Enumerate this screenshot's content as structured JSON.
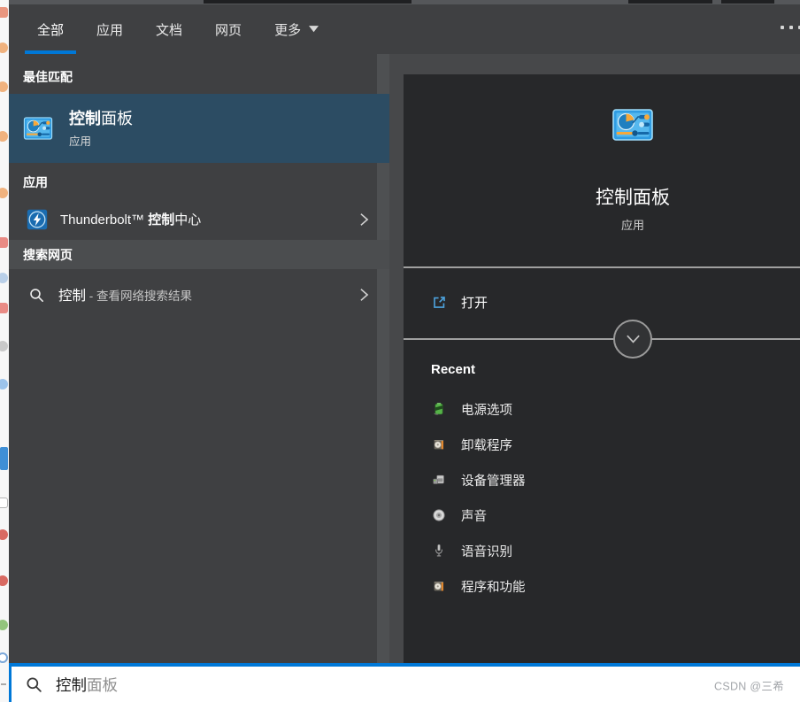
{
  "header": {
    "tabs": [
      {
        "label": "全部"
      },
      {
        "label": "应用"
      },
      {
        "label": "文档"
      },
      {
        "label": "网页"
      },
      {
        "label": "更多"
      }
    ],
    "active_tab": "全部"
  },
  "left_pane": {
    "best_match_header": "最佳匹配",
    "best_match": {
      "title_match": "控制",
      "title_rest": "面板",
      "subtitle": "应用"
    },
    "apps_header": "应用",
    "app_result": {
      "prefix": "Thunderbolt™ ",
      "match": "控制",
      "suffix": "中心"
    },
    "web_header": "搜索网页",
    "web_result": {
      "query": "控制",
      "hint": " - 查看网络搜索结果"
    }
  },
  "right_pane": {
    "app_title": "控制面板",
    "app_subtitle": "应用",
    "open_label": "打开",
    "recent_header": "Recent",
    "recent_items": [
      {
        "icon": "battery-icon",
        "label": "电源选项"
      },
      {
        "icon": "uninstall-program-icon",
        "label": "卸载程序"
      },
      {
        "icon": "device-manager-icon",
        "label": "设备管理器"
      },
      {
        "icon": "sound-icon",
        "label": "声音"
      },
      {
        "icon": "microphone-icon",
        "label": "语音识别"
      },
      {
        "icon": "programs-features-icon",
        "label": "程序和功能"
      }
    ]
  },
  "search_bar": {
    "typed_text": "控制",
    "suggestion_text": "面板"
  },
  "watermark": "CSDN @三希",
  "colors": {
    "accent_blue": "#0078d7",
    "highlight_row": "#2c4c63",
    "panel_dark": "#27282a",
    "panel_mid": "#3f4042"
  }
}
